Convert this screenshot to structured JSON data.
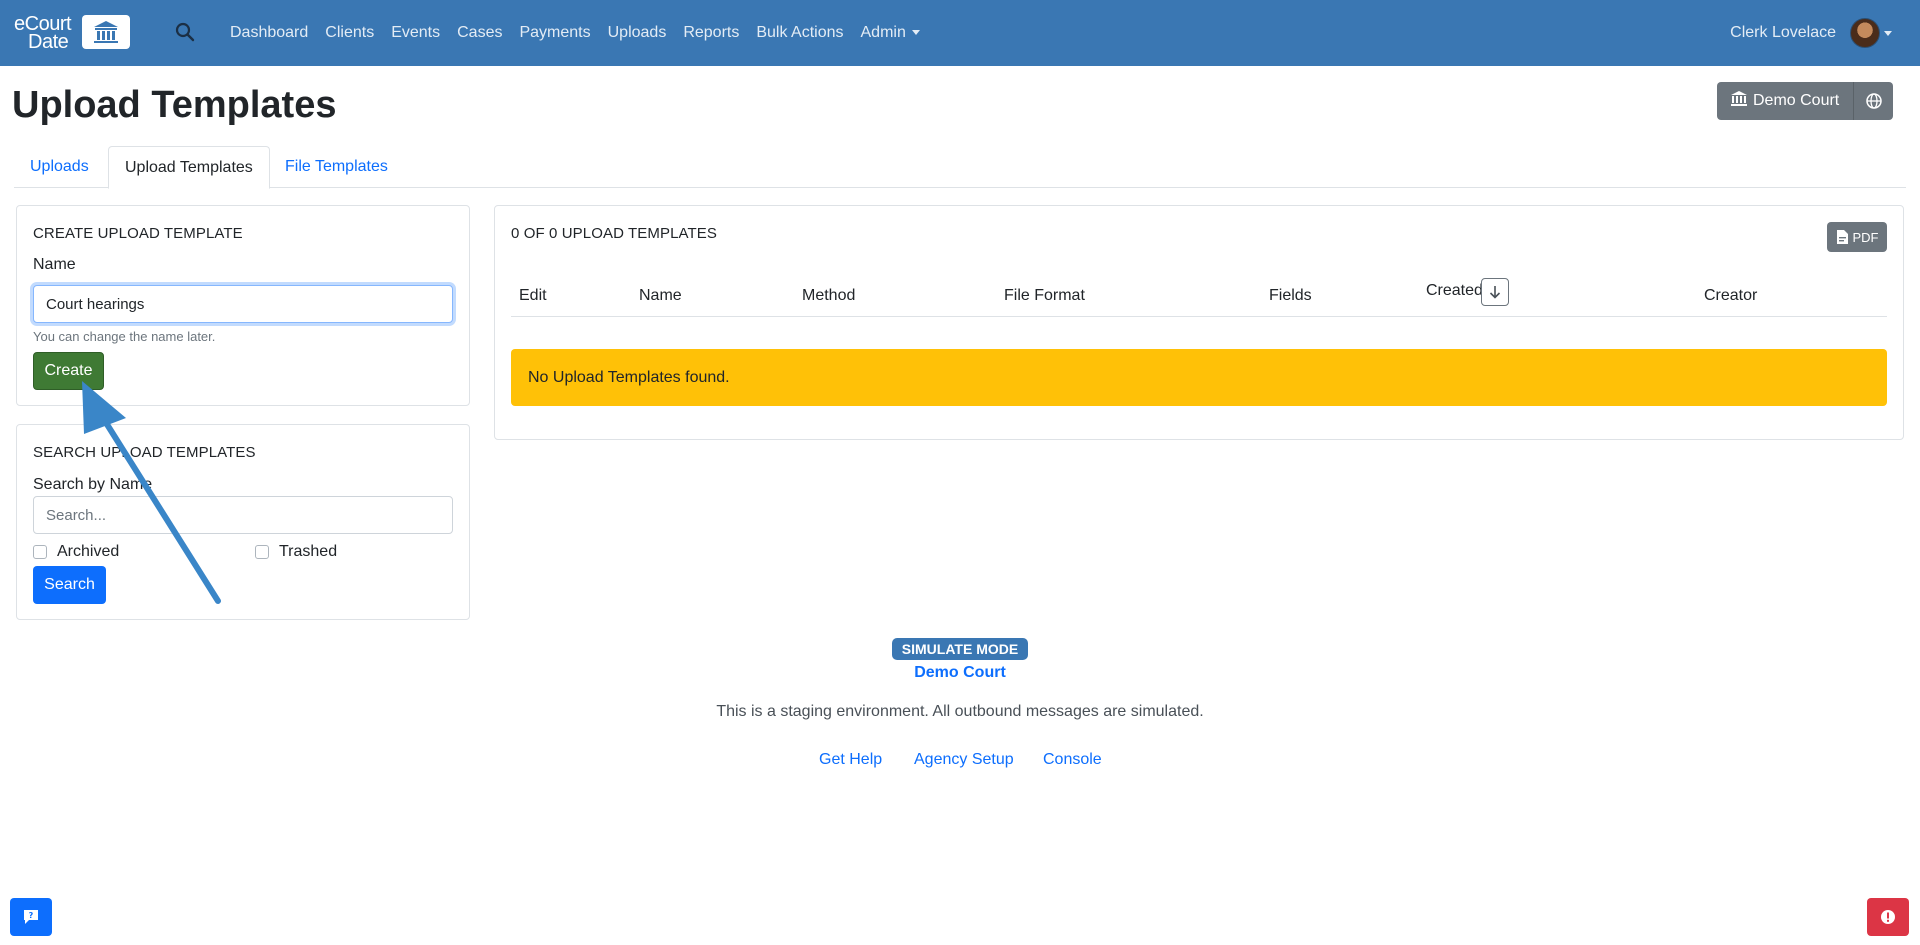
{
  "navbar": {
    "logo_line1": "eCourt",
    "logo_line2": "Date",
    "links": [
      "Dashboard",
      "Clients",
      "Events",
      "Cases",
      "Payments",
      "Uploads",
      "Reports",
      "Bulk Actions",
      "Admin"
    ],
    "user_name": "Clerk Lovelace"
  },
  "header": {
    "title": "Upload Templates",
    "court_button": "Demo Court"
  },
  "tabs": [
    "Uploads",
    "Upload Templates",
    "File Templates"
  ],
  "create_card": {
    "heading": "CREATE UPLOAD TEMPLATE",
    "name_label": "Name",
    "name_value": "Court hearings",
    "help_text": "You can change the name later.",
    "create_label": "Create"
  },
  "search_card": {
    "heading": "SEARCH UPLOAD TEMPLATES",
    "search_label": "Search by Name",
    "search_placeholder": "Search...",
    "archived_label": "Archived",
    "trashed_label": "Trashed",
    "search_button": "Search"
  },
  "results": {
    "heading": "0 OF 0 UPLOAD TEMPLATES",
    "pdf_label": "PDF",
    "columns": [
      "Edit",
      "Name",
      "Method",
      "File Format",
      "Fields",
      "Created",
      "Creator"
    ],
    "empty_message": "No Upload Templates found."
  },
  "footer": {
    "mode_badge": "SIMULATE MODE",
    "court_name": "Demo Court",
    "staging_text": "This is a staging environment. All outbound messages are simulated.",
    "links": [
      "Get Help",
      "Agency Setup",
      "Console"
    ]
  },
  "colors": {
    "navbar": "#3a77b3",
    "create_button": "#3f7a34",
    "primary": "#0d6efd",
    "alert_warning": "#ffc107",
    "annotation_arrow": "#3a86c8"
  },
  "icons": [
    "courthouse-icon",
    "search-icon",
    "globe-icon",
    "pdf-file-icon",
    "arrow-down-icon",
    "chat-icon",
    "alert-icon"
  ]
}
